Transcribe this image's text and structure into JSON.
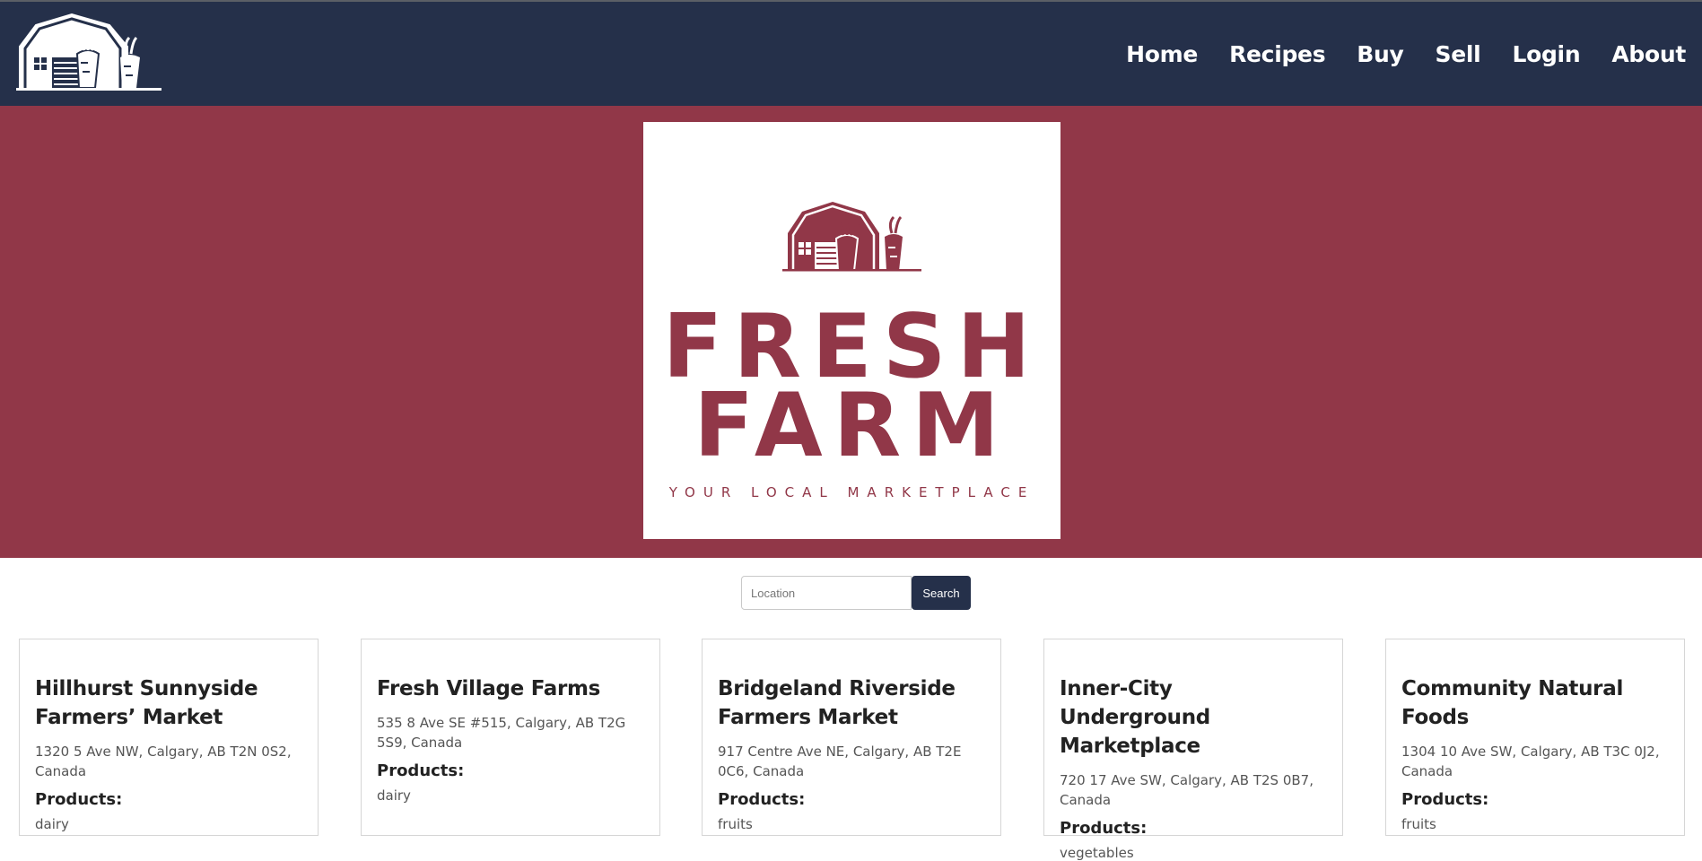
{
  "nav": {
    "logo_icon": "barn-with-carrots-logo-icon",
    "links": [
      "Home",
      "Recipes",
      "Buy",
      "Sell",
      "Login",
      "About"
    ]
  },
  "hero": {
    "logo_icon": "barn-with-carrots-logo-icon",
    "word1": "FRESH",
    "word2": "FARM",
    "tagline": "YOUR LOCAL MARKETPLACE"
  },
  "search": {
    "placeholder": "Location",
    "button_label": "Search"
  },
  "markets": [
    {
      "name": "Hillhurst Sunnyside Farmers’ Market",
      "address": "1320 5 Ave NW, Calgary, AB T2N 0S2, Canada",
      "products_label": "Products:",
      "products": "dairy"
    },
    {
      "name": "Fresh Village Farms",
      "address": "535 8 Ave SE #515, Calgary, AB T2G 5S9, Canada",
      "products_label": "Products:",
      "products": "dairy"
    },
    {
      "name": "Bridgeland Riverside Farmers Market",
      "address": "917 Centre Ave NE, Calgary, AB T2E 0C6, Canada",
      "products_label": "Products:",
      "products": "fruits"
    },
    {
      "name": "Inner-City Underground Marketplace",
      "address": "720 17 Ave SW, Calgary, AB T2S 0B7, Canada",
      "products_label": "Products:",
      "products": "vegetables"
    },
    {
      "name": "Community Natural Foods",
      "address": "1304 10 Ave SW, Calgary, AB T3C 0J2, Canada",
      "products_label": "Products:",
      "products": "fruits"
    }
  ],
  "colors": {
    "nav_bg": "#25304a",
    "hero_bg": "#913748",
    "accent": "#913748"
  }
}
